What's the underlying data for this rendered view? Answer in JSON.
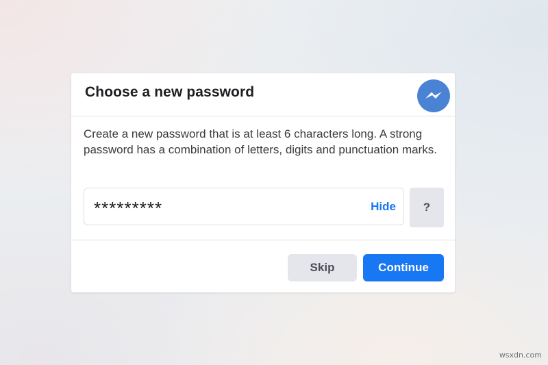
{
  "dialog": {
    "title": "Choose a new password",
    "instructions": "Create a new password that is at least 6 characters long. A strong password has a combination of letters, digits and punctuation marks.",
    "password_value": "*********",
    "hide_label": "Hide",
    "help_label": "?",
    "skip_label": "Skip",
    "continue_label": "Continue"
  },
  "icons": {
    "messenger": "messenger-icon"
  },
  "watermark": "wsxdn.com",
  "colors": {
    "accent": "#1877f2",
    "messenger_blue": "#4a83d4",
    "secondary_button": "#e4e6eb",
    "title_text": "#1c1e21"
  }
}
